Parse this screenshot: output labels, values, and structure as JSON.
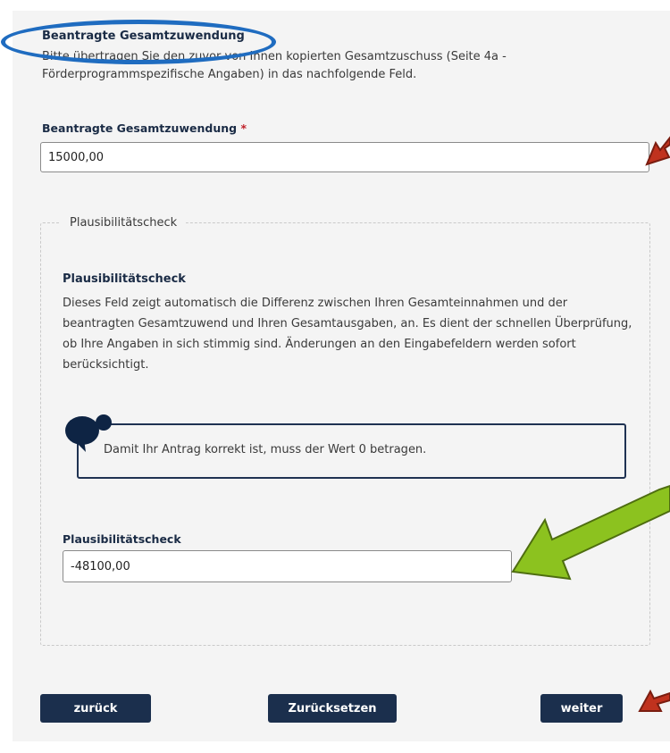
{
  "section": {
    "title": "Beantragte Gesamtzuwendung",
    "intro": "Bitte übertragen Sie den zuvor von Ihnen kopierten Gesamtzuschuss (Seite 4a - Förderprogrammspezifische Angaben) in das nachfolgende Feld."
  },
  "grant_field": {
    "label": "Beantragte Gesamtzuwendung",
    "required_mark": "*",
    "value": "15000,00"
  },
  "plausibility": {
    "legend": "Plausibilitätscheck",
    "heading": "Plausibilitätscheck",
    "description": "Dieses Feld zeigt automatisch die Differenz zwischen Ihren Gesamteinnahmen und der beantragten Gesamtzuwend und Ihren Gesamtausgaben, an. Es dient der schnellen Überprüfung, ob Ihre Angaben in sich stimmig sind. Änderungen an den Eingabefeldern werden sofort berücksichtigt.",
    "info_text": "Damit Ihr Antrag korrekt ist, muss der Wert 0 betragen.",
    "field_label": "Plausibilitätscheck",
    "field_value": "-48100,00"
  },
  "buttons": {
    "back": "zurück",
    "reset": "Zurücksetzen",
    "next": "weiter"
  },
  "colors": {
    "primary": "#1b2f4d",
    "annotation_oval": "#1f6cc0",
    "annotation_red_arrow": "#c0321e",
    "annotation_green_arrow": "#8cc21f"
  }
}
